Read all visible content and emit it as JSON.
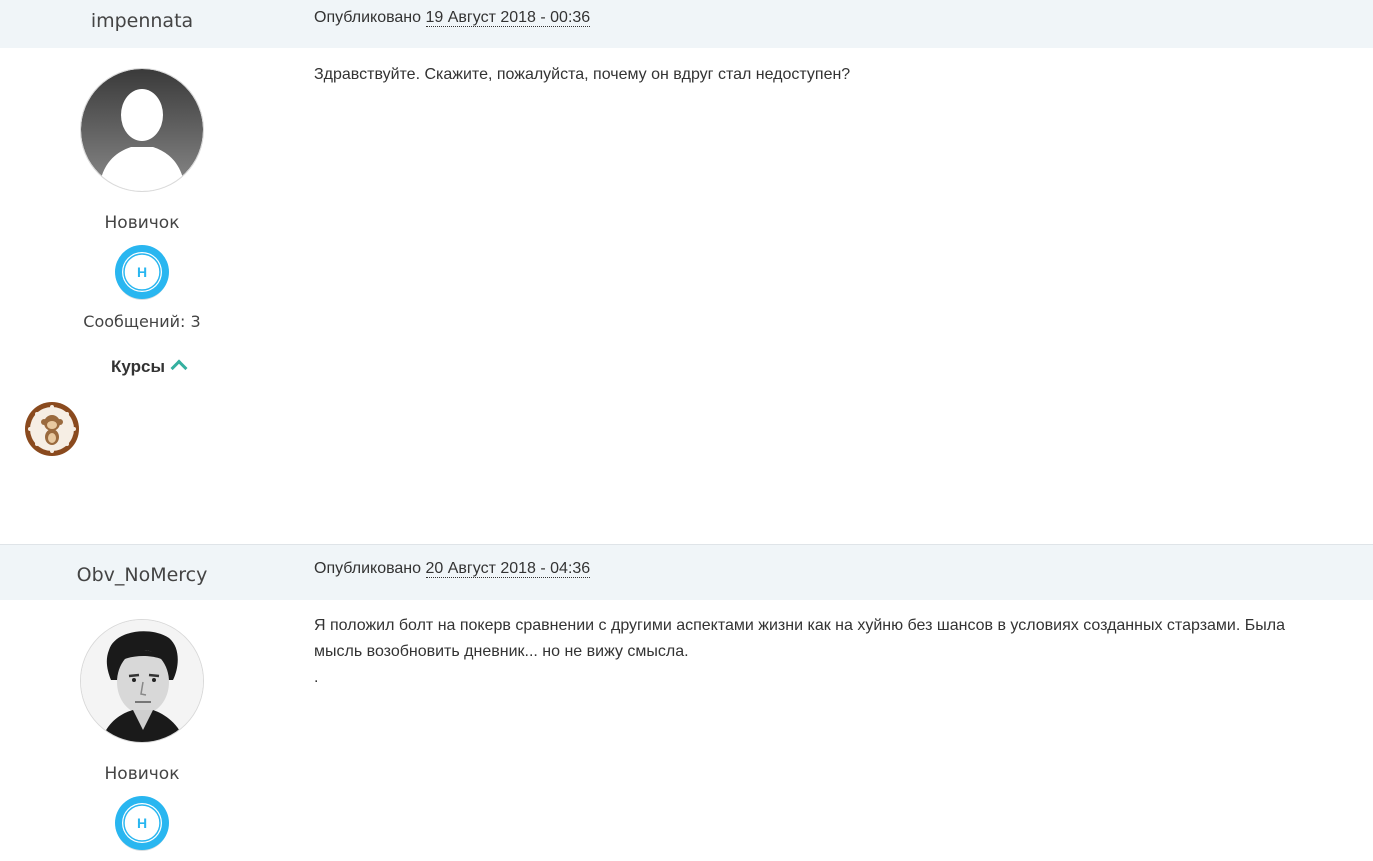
{
  "posts": [
    {
      "author": "impennata",
      "published_prefix": "Опубликовано",
      "date": "19 Август 2018 - 00:36",
      "rank": "Новичок",
      "rank_badge_letter": "Н",
      "post_count": "Сообщений: 3",
      "courses_label": "Курсы",
      "body": "Здравствуйте. Скажите, пожалуйста, почему он вдруг стал недоступен?"
    },
    {
      "author": "Obv_NoMercy",
      "published_prefix": "Опубликовано",
      "date": "20 Август 2018 - 04:36",
      "rank": "Новичок",
      "rank_badge_letter": "Н",
      "body_line1": "Я положил болт на покерв сравнении с другими аспектами жизни  как на хуйню без шансов в условиях созданных старзами. Была",
      "body_line2": "мысль возобновить дневник... но не вижу смысла.",
      "body_line3": "."
    }
  ],
  "colors": {
    "header_bg": "#f0f5f8",
    "badge_blue": "#29b6f0",
    "chevron": "#35b0a0"
  }
}
